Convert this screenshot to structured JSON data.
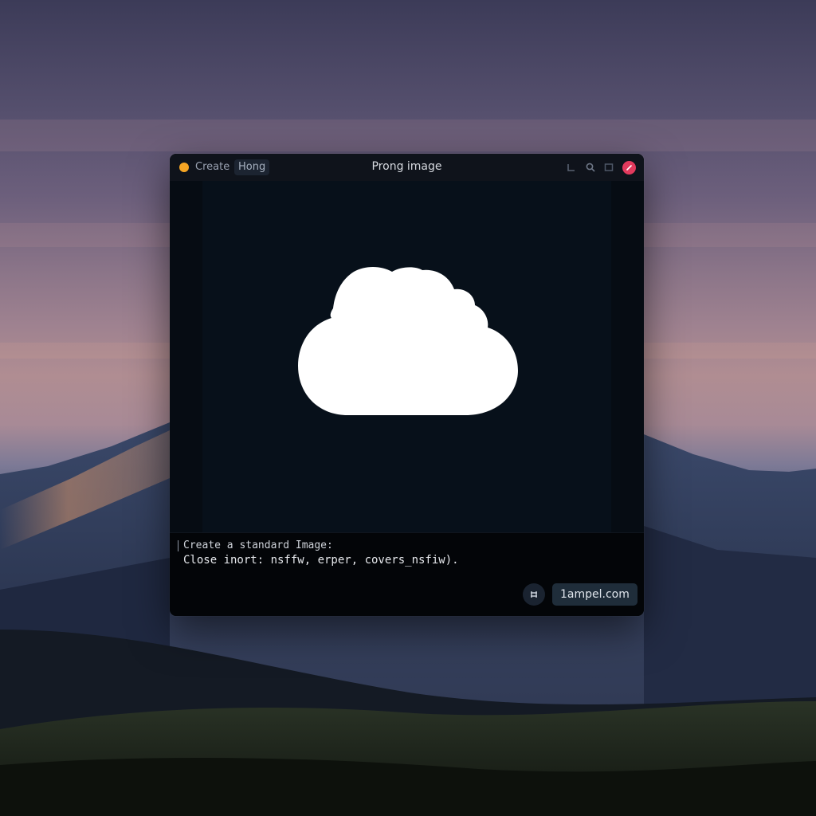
{
  "window": {
    "title": "Prong image",
    "tabs": [
      {
        "label": "Create",
        "active": false
      },
      {
        "label": "Hong",
        "active": true
      }
    ],
    "toolbar_icons": [
      "corner-icon",
      "search-icon",
      "square-icon"
    ],
    "status_dot_color": "#f5a524",
    "close_color": "#e23a5d"
  },
  "canvas": {
    "icon": "cloud-icon",
    "background": "#07101a"
  },
  "prompt": {
    "line1": "Create a standard Image:",
    "line2": "Close inort: nsffw, erper, covers_nsfiw)."
  },
  "footer": {
    "grid_icon": "grid-icon",
    "site_label": "1ampel.com"
  }
}
